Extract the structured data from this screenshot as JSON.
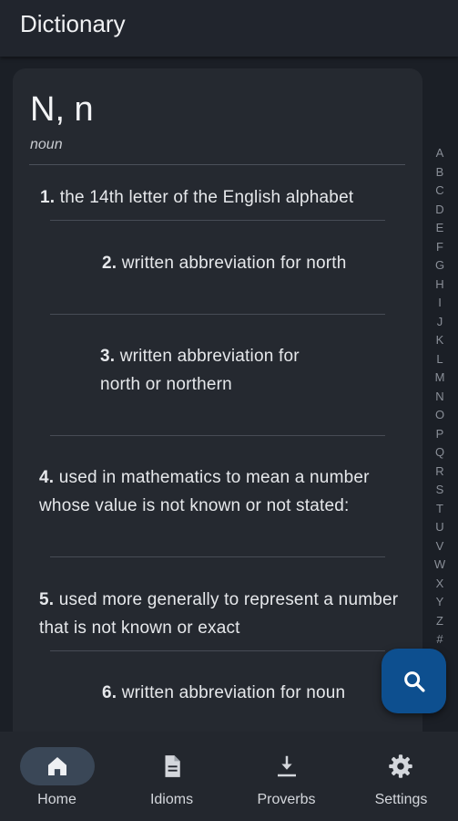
{
  "app": {
    "title": "Dictionary"
  },
  "entry": {
    "headword": "N, n",
    "pos": "noun",
    "definitions": [
      {
        "num": "1.",
        "text": " the 14th letter of the English alphabet"
      },
      {
        "num": "2.",
        "text": " written abbreviation for north"
      },
      {
        "num": "3.",
        "text": " written abbreviation for north  or northern"
      },
      {
        "num": "4.",
        "text": " used in mathematics to mean a number whose value is not known or not stated:"
      },
      {
        "num": "5.",
        "text": " used more generally to represent a number that is not known or exact"
      },
      {
        "num": "6.",
        "text": " written abbreviation for noun"
      }
    ]
  },
  "alphabet": [
    "A",
    "B",
    "C",
    "D",
    "E",
    "F",
    "G",
    "H",
    "I",
    "J",
    "K",
    "L",
    "M",
    "N",
    "O",
    "P",
    "Q",
    "R",
    "S",
    "T",
    "U",
    "V",
    "W",
    "X",
    "Y",
    "Z",
    "#"
  ],
  "fab": {
    "icon": "search-icon"
  },
  "nav": {
    "items": [
      {
        "label": "Home",
        "icon": "home-icon",
        "active": true
      },
      {
        "label": "Idioms",
        "icon": "document-icon",
        "active": false
      },
      {
        "label": "Proverbs",
        "icon": "download-icon",
        "active": false
      },
      {
        "label": "Settings",
        "icon": "gear-icon",
        "active": false
      }
    ]
  },
  "colors": {
    "background": "#1b1f26",
    "appbar": "#21252d",
    "card": "#252930",
    "fab": "#0d4f8f",
    "nav_active_pill": "#3a4757",
    "text": "#e4e6ea",
    "index_text": "#8a8f98"
  }
}
